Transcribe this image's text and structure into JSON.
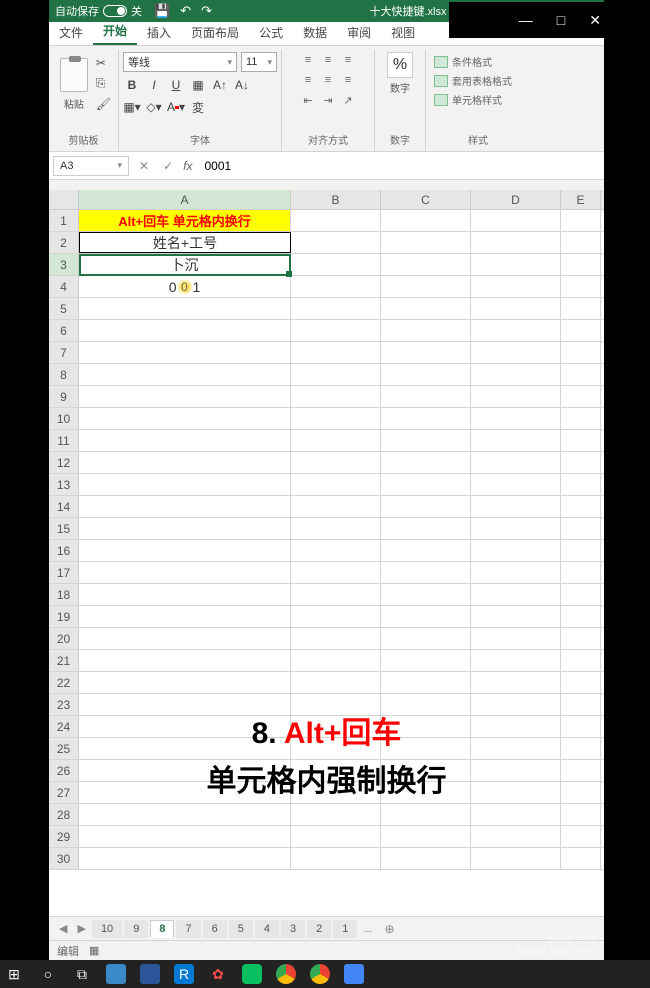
{
  "titlebar": {
    "autosave_label": "自动保存",
    "autosave_state": "关",
    "filename": "十大快捷键.xlsx"
  },
  "window_controls": {
    "min": "—",
    "max": "□",
    "close": "✕"
  },
  "tabs": {
    "file": "文件",
    "home": "开始",
    "insert": "插入",
    "layout": "页面布局",
    "formulas": "公式",
    "data": "数据",
    "review": "审阅",
    "view": "视图"
  },
  "ribbon": {
    "clipboard": {
      "paste": "粘贴",
      "label": "剪贴板"
    },
    "font": {
      "name": "等线",
      "size": "11",
      "label": "字体"
    },
    "alignment": {
      "label": "对齐方式"
    },
    "number": {
      "pct": "%",
      "sub": "数字",
      "label": "数字"
    },
    "styles": {
      "cond": "条件格式",
      "table": "套用表格格式",
      "cell": "单元格样式",
      "label": "样式"
    }
  },
  "formula_bar": {
    "name_box": "A3",
    "value": "0001"
  },
  "columns": [
    "A",
    "B",
    "C",
    "D",
    "E"
  ],
  "cells": {
    "A1": "Alt+回车  单元格内换行",
    "A2": "姓名+工号",
    "A3": "卜沉",
    "A4_prefix": "0",
    "A4_mid": "0",
    "A4_suffix": "1"
  },
  "caption": {
    "num": "8.",
    "red": "Alt+回车",
    "line2": "单元格内强制换行"
  },
  "sheet_tabs": [
    "10",
    "9",
    "8",
    "7",
    "6",
    "5",
    "4",
    "3",
    "2",
    "1"
  ],
  "sheet_active": "8",
  "sheet_more": "...",
  "status": {
    "mode": "编辑"
  },
  "watermark": {
    "brand": "Baidu 经验",
    "url": "jingyan.baidu.com"
  }
}
